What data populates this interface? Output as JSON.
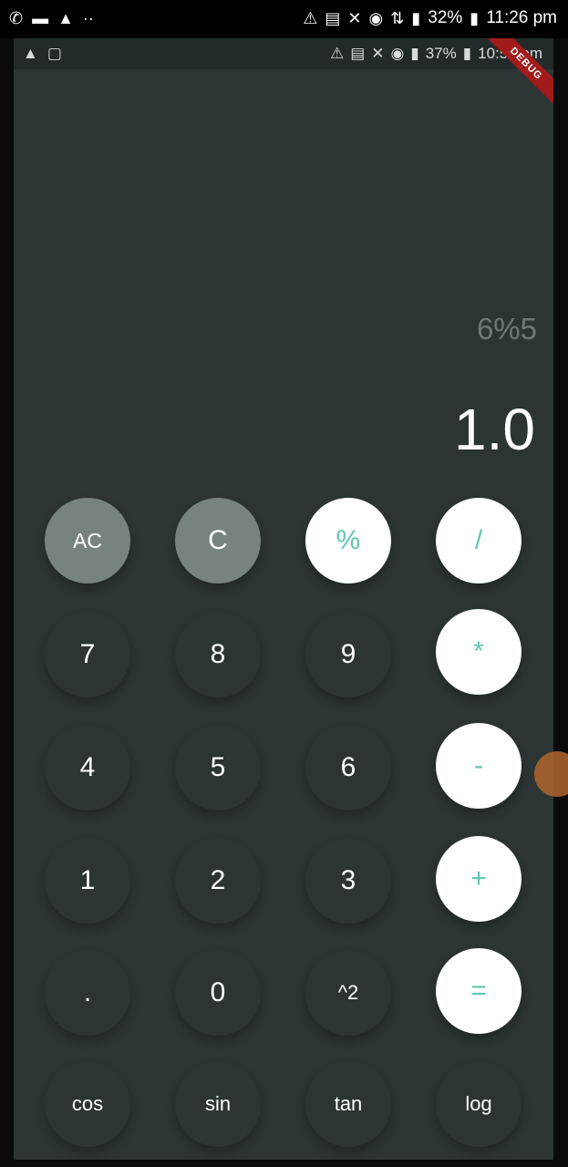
{
  "outer_status": {
    "left_icons": [
      "whatsapp-icon",
      "folder-icon",
      "warning-icon",
      "dots-icon"
    ],
    "right_icons": [
      "network-icon",
      "cast-icon",
      "mute-icon",
      "alarm-icon",
      "data-icon",
      "signal-icon"
    ],
    "battery": "32%",
    "time": "11:26 pm"
  },
  "inner_status": {
    "left_icons": [
      "warning-icon",
      "clipboard-icon"
    ],
    "battery": "37%",
    "time": "10:54 pm",
    "debug_label": "DEBUG"
  },
  "display": {
    "expression": "6%5",
    "result": "1.0"
  },
  "buttons": {
    "ac": "AC",
    "c": "C",
    "percent": "%",
    "divide": "/",
    "seven": "7",
    "eight": "8",
    "nine": "9",
    "multiply": "*",
    "four": "4",
    "five": "5",
    "six": "6",
    "minus": "-",
    "one": "1",
    "two": "2",
    "three": "3",
    "plus": "+",
    "dot": ".",
    "zero": "0",
    "square": "^2",
    "equals": "=",
    "cos": "cos",
    "sin": "sin",
    "tan": "tan",
    "log": "log"
  },
  "colors": {
    "background": "#2c3534",
    "accent": "#5dc8b3",
    "gray_button": "#768381",
    "white_button": "#ffffff"
  }
}
